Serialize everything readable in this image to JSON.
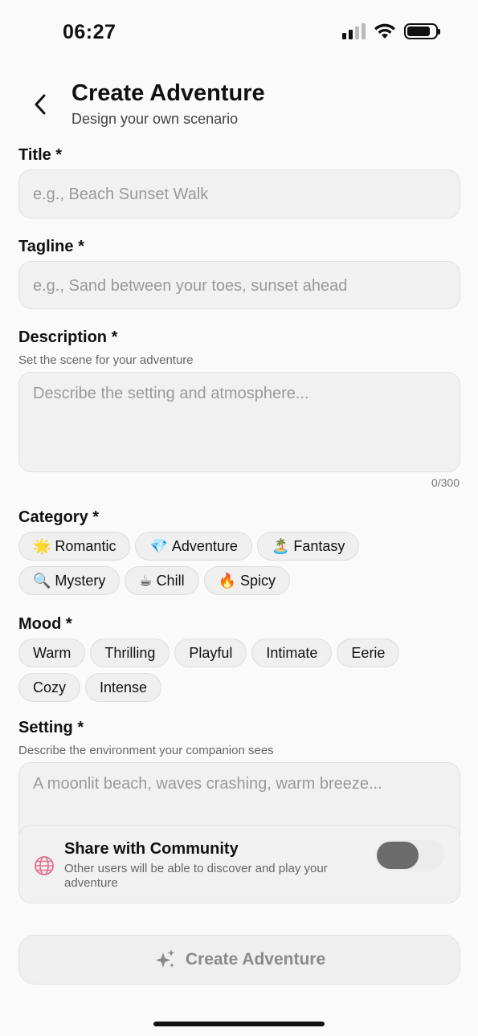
{
  "status_bar": {
    "time": "06:27"
  },
  "header": {
    "title": "Create Adventure",
    "subtitle": "Design your own scenario"
  },
  "form": {
    "title": {
      "label": "Title *",
      "placeholder": "e.g., Beach Sunset Walk"
    },
    "tagline": {
      "label": "Tagline *",
      "placeholder": "e.g., Sand between your toes, sunset ahead"
    },
    "description": {
      "label": "Description *",
      "hint": "Set the scene for your adventure",
      "placeholder": "Describe the setting and atmosphere...",
      "counter": "0/300"
    },
    "category": {
      "label": "Category *",
      "options": [
        {
          "emoji": "🌟",
          "label": "Romantic"
        },
        {
          "emoji": "💎",
          "label": "Adventure"
        },
        {
          "emoji": "🏝️",
          "label": "Fantasy"
        },
        {
          "emoji": "🔍",
          "label": "Mystery"
        },
        {
          "emoji": "☕",
          "label": "Chill"
        },
        {
          "emoji": "🔥",
          "label": "Spicy"
        }
      ]
    },
    "mood": {
      "label": "Mood *",
      "options": [
        "Warm",
        "Thrilling",
        "Playful",
        "Intimate",
        "Eerie",
        "Cozy",
        "Intense"
      ]
    },
    "setting": {
      "label": "Setting *",
      "hint": "Describe the environment your companion sees",
      "placeholder": "A moonlit beach, waves crashing, warm breeze..."
    },
    "share": {
      "title": "Share with Community",
      "description": "Other users will be able to discover and play your adventure",
      "enabled": false
    }
  },
  "submit": {
    "label": "Create Adventure"
  }
}
